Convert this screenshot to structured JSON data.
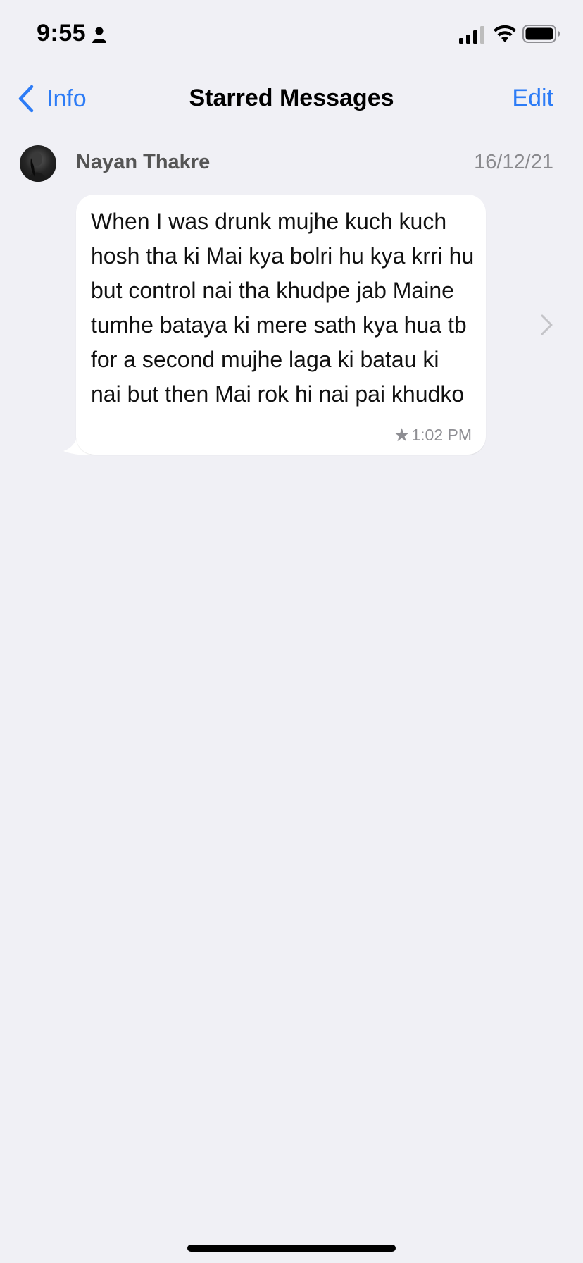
{
  "status_bar": {
    "time": "9:55"
  },
  "nav": {
    "back_label": "Info",
    "title": "Starred Messages",
    "edit_label": "Edit"
  },
  "messages": [
    {
      "sender": "Nayan Thakre",
      "date": "16/12/21",
      "text": "When I was drunk mujhe kuch kuch hosh tha ki Mai kya bolri hu kya krri hu but control nai tha khudpe jab Maine tumhe bataya ki mere sath kya hua tb for a second mujhe laga ki batau ki nai but then Mai rok hi nai pai khudko",
      "time": "1:02 PM",
      "starred_icon": "star-icon"
    }
  ],
  "colors": {
    "accent": "#2d7cf6",
    "background": "#f0f0f5",
    "bubble": "#ffffff",
    "secondary_text": "#8e8e93"
  }
}
